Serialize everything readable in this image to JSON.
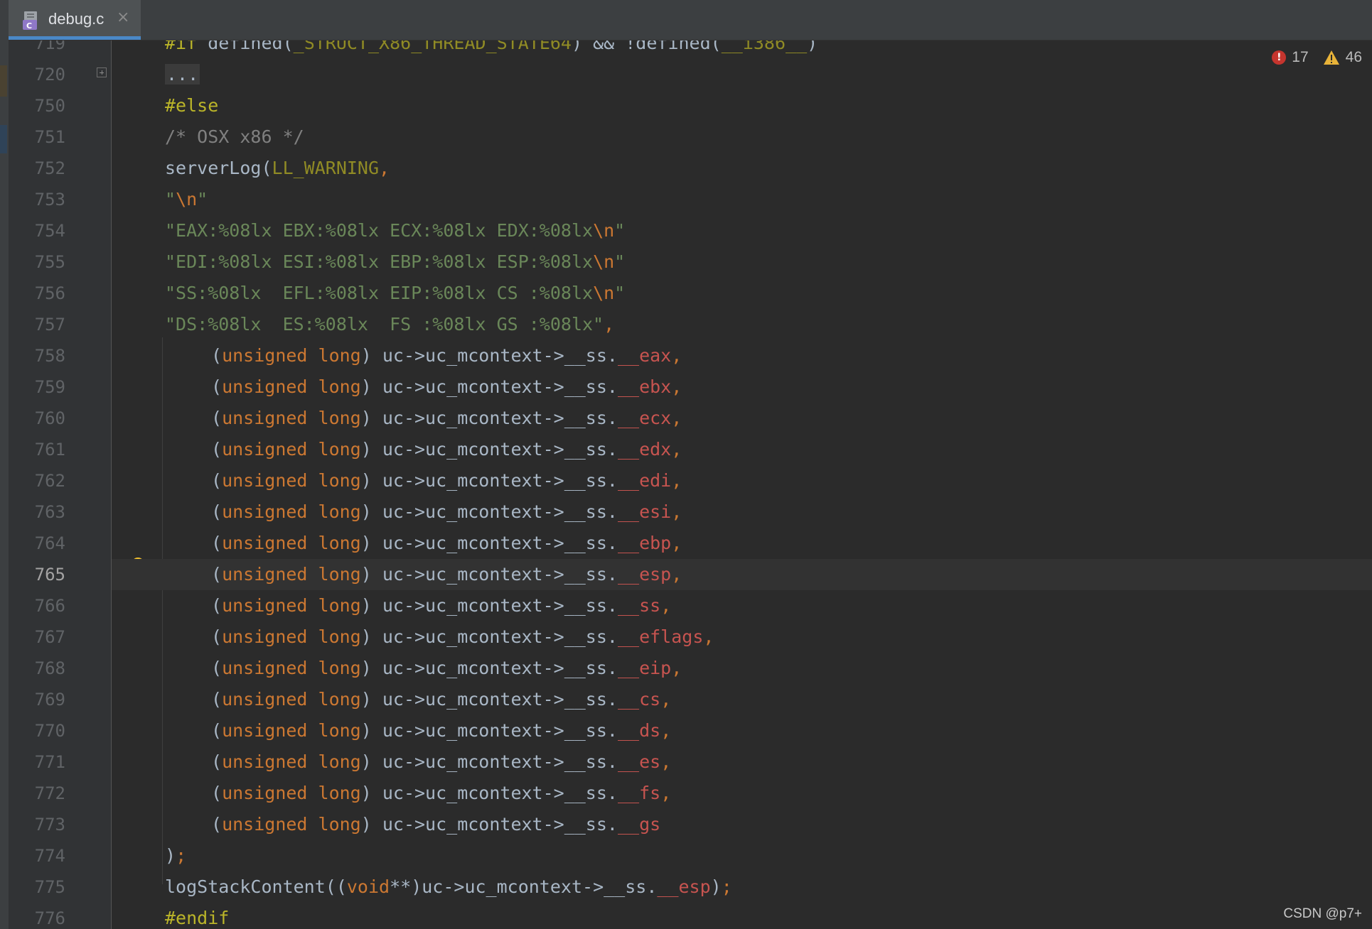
{
  "tab": {
    "title": "debug.c",
    "close_glyph": "×",
    "icon_badge": "C"
  },
  "inspections": {
    "errors": "17",
    "warnings": "46"
  },
  "watermark": "CSDN @p7+",
  "lines": [
    {
      "n": "719",
      "indent": 0,
      "tokens": [
        {
          "t": "#if ",
          "c": "pre"
        },
        {
          "t": "defined(",
          "c": "id"
        },
        {
          "t": "_STRUCT_X86_THREAD_STATE64",
          "c": "mac"
        },
        {
          "t": ") && !",
          "c": "id"
        },
        {
          "t": "defined(",
          "c": "id"
        },
        {
          "t": "__i386__",
          "c": "mac"
        },
        {
          "t": ")",
          "c": "id"
        }
      ]
    },
    {
      "n": "720",
      "indent": 0,
      "fold": true,
      "tokens": [
        {
          "t": "...",
          "c": "dots"
        }
      ]
    },
    {
      "n": "750",
      "indent": 0,
      "tokens": [
        {
          "t": "#else",
          "c": "pre"
        }
      ]
    },
    {
      "n": "751",
      "indent": 0,
      "tokens": [
        {
          "t": "/* OSX x86 */",
          "c": "cmt"
        }
      ]
    },
    {
      "n": "752",
      "indent": 0,
      "tokens": [
        {
          "t": "serverLog(",
          "c": "fn"
        },
        {
          "t": "LL_WARNING",
          "c": "mac"
        },
        {
          "t": ",",
          "c": "punc"
        }
      ]
    },
    {
      "n": "753",
      "indent": 0,
      "tokens": [
        {
          "t": "\"",
          "c": "str"
        },
        {
          "t": "\\n",
          "c": "esc"
        },
        {
          "t": "\"",
          "c": "str"
        }
      ]
    },
    {
      "n": "754",
      "indent": 0,
      "tokens": [
        {
          "t": "\"EAX:%08lx EBX:%08lx ECX:%08lx EDX:%08lx",
          "c": "str"
        },
        {
          "t": "\\n",
          "c": "esc"
        },
        {
          "t": "\"",
          "c": "str"
        }
      ]
    },
    {
      "n": "755",
      "indent": 0,
      "tokens": [
        {
          "t": "\"EDI:%08lx ESI:%08lx EBP:%08lx ESP:%08lx",
          "c": "str"
        },
        {
          "t": "\\n",
          "c": "esc"
        },
        {
          "t": "\"",
          "c": "str"
        }
      ]
    },
    {
      "n": "756",
      "indent": 0,
      "tokens": [
        {
          "t": "\"SS:%08lx  EFL:%08lx EIP:%08lx CS :%08lx",
          "c": "str"
        },
        {
          "t": "\\n",
          "c": "esc"
        },
        {
          "t": "\"",
          "c": "str"
        }
      ]
    },
    {
      "n": "757",
      "indent": 0,
      "tokens": [
        {
          "t": "\"DS:%08lx  ES:%08lx  FS :%08lx GS :%08lx\"",
          "c": "str"
        },
        {
          "t": ",",
          "c": "punc"
        }
      ]
    },
    {
      "n": "758",
      "indent": 1,
      "tokens": [
        {
          "t": "(",
          "c": "paren"
        },
        {
          "t": "unsigned long",
          "c": "kw"
        },
        {
          "t": ") uc->uc_mcontext->__ss.",
          "c": "id"
        },
        {
          "t": "__eax",
          "c": "fld"
        },
        {
          "t": ",",
          "c": "punc"
        }
      ]
    },
    {
      "n": "759",
      "indent": 1,
      "tokens": [
        {
          "t": "(",
          "c": "paren"
        },
        {
          "t": "unsigned long",
          "c": "kw"
        },
        {
          "t": ") uc->uc_mcontext->__ss.",
          "c": "id"
        },
        {
          "t": "__ebx",
          "c": "fld"
        },
        {
          "t": ",",
          "c": "punc"
        }
      ]
    },
    {
      "n": "760",
      "indent": 1,
      "tokens": [
        {
          "t": "(",
          "c": "paren"
        },
        {
          "t": "unsigned long",
          "c": "kw"
        },
        {
          "t": ") uc->uc_mcontext->__ss.",
          "c": "id"
        },
        {
          "t": "__ecx",
          "c": "fld"
        },
        {
          "t": ",",
          "c": "punc"
        }
      ]
    },
    {
      "n": "761",
      "indent": 1,
      "tokens": [
        {
          "t": "(",
          "c": "paren"
        },
        {
          "t": "unsigned long",
          "c": "kw"
        },
        {
          "t": ") uc->uc_mcontext->__ss.",
          "c": "id"
        },
        {
          "t": "__edx",
          "c": "fld"
        },
        {
          "t": ",",
          "c": "punc"
        }
      ]
    },
    {
      "n": "762",
      "indent": 1,
      "tokens": [
        {
          "t": "(",
          "c": "paren"
        },
        {
          "t": "unsigned long",
          "c": "kw"
        },
        {
          "t": ") uc->uc_mcontext->__ss.",
          "c": "id"
        },
        {
          "t": "__edi",
          "c": "fld"
        },
        {
          "t": ",",
          "c": "punc"
        }
      ]
    },
    {
      "n": "763",
      "indent": 1,
      "tokens": [
        {
          "t": "(",
          "c": "paren"
        },
        {
          "t": "unsigned long",
          "c": "kw"
        },
        {
          "t": ") uc->uc_mcontext->__ss.",
          "c": "id"
        },
        {
          "t": "__esi",
          "c": "fld"
        },
        {
          "t": ",",
          "c": "punc"
        }
      ]
    },
    {
      "n": "764",
      "indent": 1,
      "tokens": [
        {
          "t": "(",
          "c": "paren"
        },
        {
          "t": "unsigned long",
          "c": "kw"
        },
        {
          "t": ") uc->uc_mcontext->__ss.",
          "c": "id"
        },
        {
          "t": "__ebp",
          "c": "fld"
        },
        {
          "t": ",",
          "c": "punc"
        }
      ]
    },
    {
      "n": "765",
      "indent": 1,
      "current": true,
      "tokens": [
        {
          "t": "(",
          "c": "paren"
        },
        {
          "t": "unsigned long",
          "c": "kw"
        },
        {
          "t": ") uc->uc_mcontext->__ss.",
          "c": "id"
        },
        {
          "t": "__esp",
          "c": "fld"
        },
        {
          "t": ",",
          "c": "punc"
        }
      ]
    },
    {
      "n": "766",
      "indent": 1,
      "tokens": [
        {
          "t": "(",
          "c": "paren"
        },
        {
          "t": "unsigned long",
          "c": "kw"
        },
        {
          "t": ") uc->uc_mcontext->__ss.",
          "c": "id"
        },
        {
          "t": "__ss",
          "c": "fld"
        },
        {
          "t": ",",
          "c": "punc"
        }
      ]
    },
    {
      "n": "767",
      "indent": 1,
      "tokens": [
        {
          "t": "(",
          "c": "paren"
        },
        {
          "t": "unsigned long",
          "c": "kw"
        },
        {
          "t": ") uc->uc_mcontext->__ss.",
          "c": "id"
        },
        {
          "t": "__eflags",
          "c": "fld"
        },
        {
          "t": ",",
          "c": "punc"
        }
      ]
    },
    {
      "n": "768",
      "indent": 1,
      "tokens": [
        {
          "t": "(",
          "c": "paren"
        },
        {
          "t": "unsigned long",
          "c": "kw"
        },
        {
          "t": ") uc->uc_mcontext->__ss.",
          "c": "id"
        },
        {
          "t": "__eip",
          "c": "fld"
        },
        {
          "t": ",",
          "c": "punc"
        }
      ]
    },
    {
      "n": "769",
      "indent": 1,
      "tokens": [
        {
          "t": "(",
          "c": "paren"
        },
        {
          "t": "unsigned long",
          "c": "kw"
        },
        {
          "t": ") uc->uc_mcontext->__ss.",
          "c": "id"
        },
        {
          "t": "__cs",
          "c": "fld"
        },
        {
          "t": ",",
          "c": "punc"
        }
      ]
    },
    {
      "n": "770",
      "indent": 1,
      "tokens": [
        {
          "t": "(",
          "c": "paren"
        },
        {
          "t": "unsigned long",
          "c": "kw"
        },
        {
          "t": ") uc->uc_mcontext->__ss.",
          "c": "id"
        },
        {
          "t": "__ds",
          "c": "fld"
        },
        {
          "t": ",",
          "c": "punc"
        }
      ]
    },
    {
      "n": "771",
      "indent": 1,
      "tokens": [
        {
          "t": "(",
          "c": "paren"
        },
        {
          "t": "unsigned long",
          "c": "kw"
        },
        {
          "t": ") uc->uc_mcontext->__ss.",
          "c": "id"
        },
        {
          "t": "__es",
          "c": "fld"
        },
        {
          "t": ",",
          "c": "punc"
        }
      ]
    },
    {
      "n": "772",
      "indent": 1,
      "tokens": [
        {
          "t": "(",
          "c": "paren"
        },
        {
          "t": "unsigned long",
          "c": "kw"
        },
        {
          "t": ") uc->uc_mcontext->__ss.",
          "c": "id"
        },
        {
          "t": "__fs",
          "c": "fld"
        },
        {
          "t": ",",
          "c": "punc"
        }
      ]
    },
    {
      "n": "773",
      "indent": 1,
      "tokens": [
        {
          "t": "(",
          "c": "paren"
        },
        {
          "t": "unsigned long",
          "c": "kw"
        },
        {
          "t": ") uc->uc_mcontext->__ss.",
          "c": "id"
        },
        {
          "t": "__gs",
          "c": "fld"
        }
      ]
    },
    {
      "n": "774",
      "indent": 0,
      "tokens": [
        {
          "t": ")",
          "c": "paren"
        },
        {
          "t": ";",
          "c": "punc"
        }
      ]
    },
    {
      "n": "775",
      "indent": 0,
      "tokens": [
        {
          "t": "logStackContent((",
          "c": "fn"
        },
        {
          "t": "void",
          "c": "kw"
        },
        {
          "t": "**)uc->uc_mcontext->__ss.",
          "c": "id"
        },
        {
          "t": "__esp",
          "c": "fld"
        },
        {
          "t": ")",
          "c": "id"
        },
        {
          "t": ";",
          "c": "punc"
        }
      ]
    },
    {
      "n": "776",
      "indent": 0,
      "tokens": [
        {
          "t": "#endif",
          "c": "pre"
        }
      ]
    }
  ]
}
